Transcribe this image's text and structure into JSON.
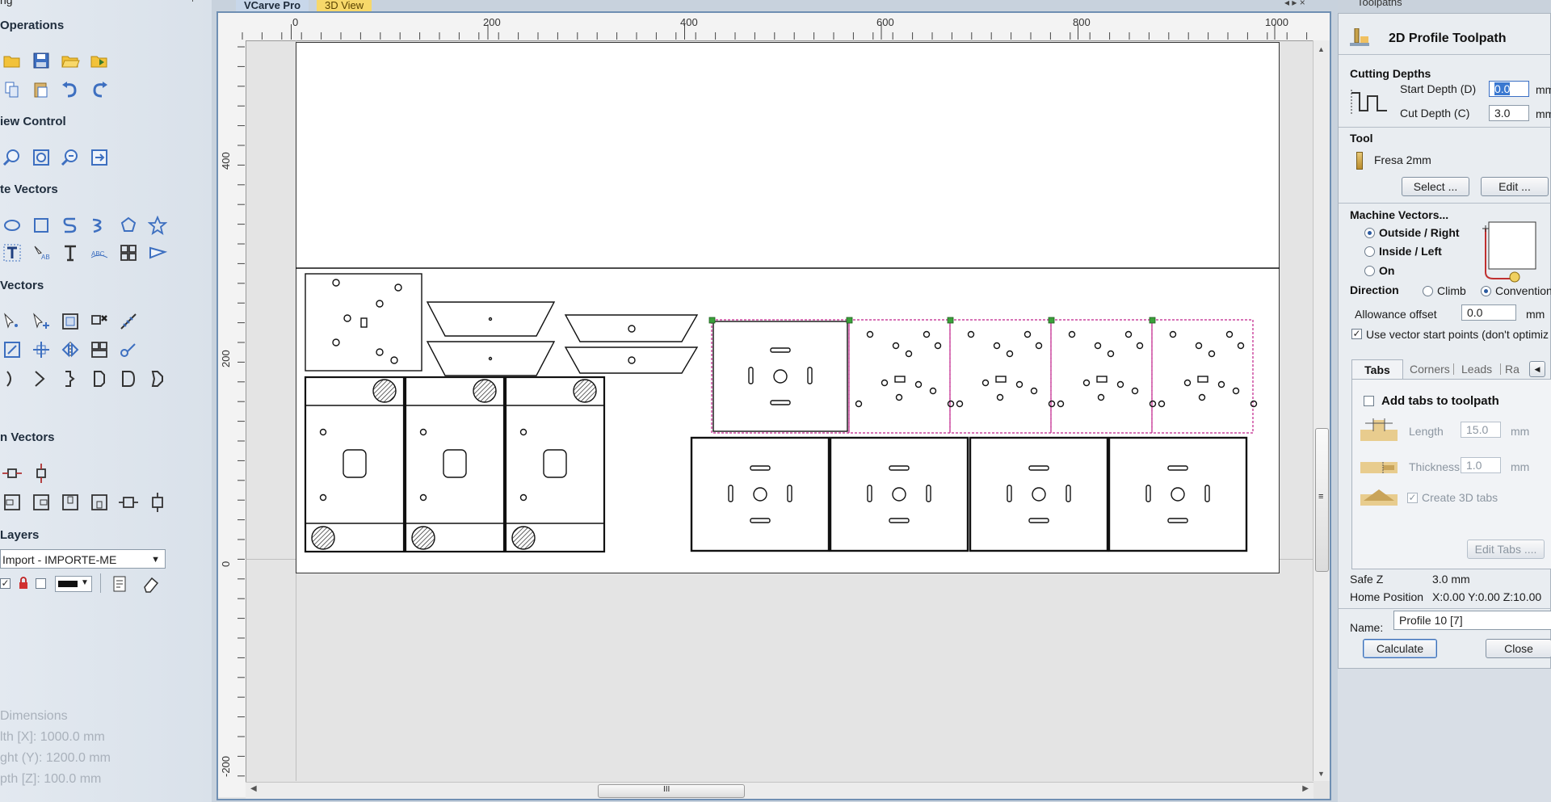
{
  "left": {
    "top_cut": "ng",
    "sections": {
      "operations": "Operations",
      "view_control": "iew Control",
      "create_vectors": "te Vectors",
      "edit_vectors": "Vectors",
      "offset_vectors": "n Vectors",
      "layers": "Layers"
    },
    "layer_select": "Import - IMPORTE-ME",
    "dimensions": {
      "title": "Dimensions",
      "width": "lth  [X]: 1000.0 mm",
      "height": "ght (Y): 1200.0 mm",
      "depth": "pth  [Z]: 100.0 mm"
    }
  },
  "doc": {
    "tabs": [
      "VCarve Pro",
      "3D View"
    ],
    "tab_colors": {
      "active": "#c8d7ea",
      "other": "#f7d86a"
    },
    "ruler_h": [
      "0",
      "200",
      "400",
      "600",
      "800",
      "1000"
    ],
    "ruler_v": [
      "400",
      "200",
      "0",
      "-200"
    ],
    "scroll_grip_h": "III",
    "scroll_grip_v": "≡"
  },
  "right": {
    "panel_title": "Toolpaths",
    "heading": "2D Profile Toolpath",
    "cutting_depths": {
      "title": "Cutting Depths",
      "start_label": "Start Depth (D)",
      "start_value": "0.0",
      "cut_label": "Cut Depth (C)",
      "cut_value": "3.0",
      "unit": "mm"
    },
    "tool": {
      "title": "Tool",
      "name": "Fresa 2mm",
      "select_label": "Select ...",
      "edit_label": "Edit ..."
    },
    "machine_vectors": {
      "title": "Machine Vectors...",
      "outside": "Outside / Right",
      "inside": "Inside / Left",
      "on": "On"
    },
    "direction": {
      "label": "Direction",
      "climb": "Climb",
      "conventional": "Convention"
    },
    "allowance": {
      "label": "Allowance offset",
      "value": "0.0",
      "unit": "mm"
    },
    "vector_start": "Use vector start points (don't optimiz",
    "tabs": [
      "Tabs",
      "Corners",
      "Leads",
      "Ra"
    ],
    "tabs_panel": {
      "add_tabs": "Add tabs to toolpath",
      "length_label": "Length",
      "length_value": "15.0",
      "thickness_label": "Thickness",
      "thickness_value": "1.0",
      "unit": "mm",
      "create_3d": "Create 3D tabs",
      "edit_tabs": "Edit Tabs ...."
    },
    "safe_z": {
      "label": "Safe Z",
      "value": "3.0 mm"
    },
    "home_position": {
      "label": "Home Position",
      "value": "X:0.00 Y:0.00 Z:10.00"
    },
    "name": {
      "label": "Name:",
      "value": "Profile 10 [7]"
    },
    "calculate": "Calculate",
    "close": "Close"
  }
}
